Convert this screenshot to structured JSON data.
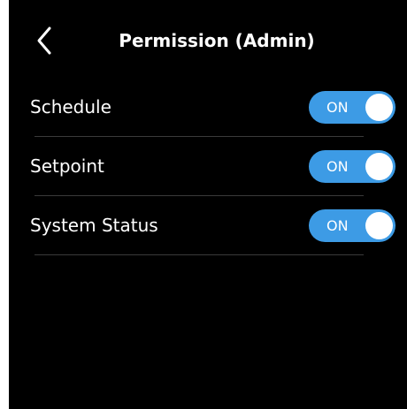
{
  "colors": {
    "background": "#000000",
    "text": "#ffffff",
    "toggle_on": "#3d9be5",
    "divider": "#3a3a3a"
  },
  "header": {
    "back_icon": "chevron-left-icon",
    "title": "Permission (Admin)"
  },
  "permissions": [
    {
      "label": "Schedule",
      "toggle_label": "ON",
      "enabled": true
    },
    {
      "label": "Setpoint",
      "toggle_label": "ON",
      "enabled": true
    },
    {
      "label": "System Status",
      "toggle_label": "ON",
      "enabled": true
    }
  ]
}
